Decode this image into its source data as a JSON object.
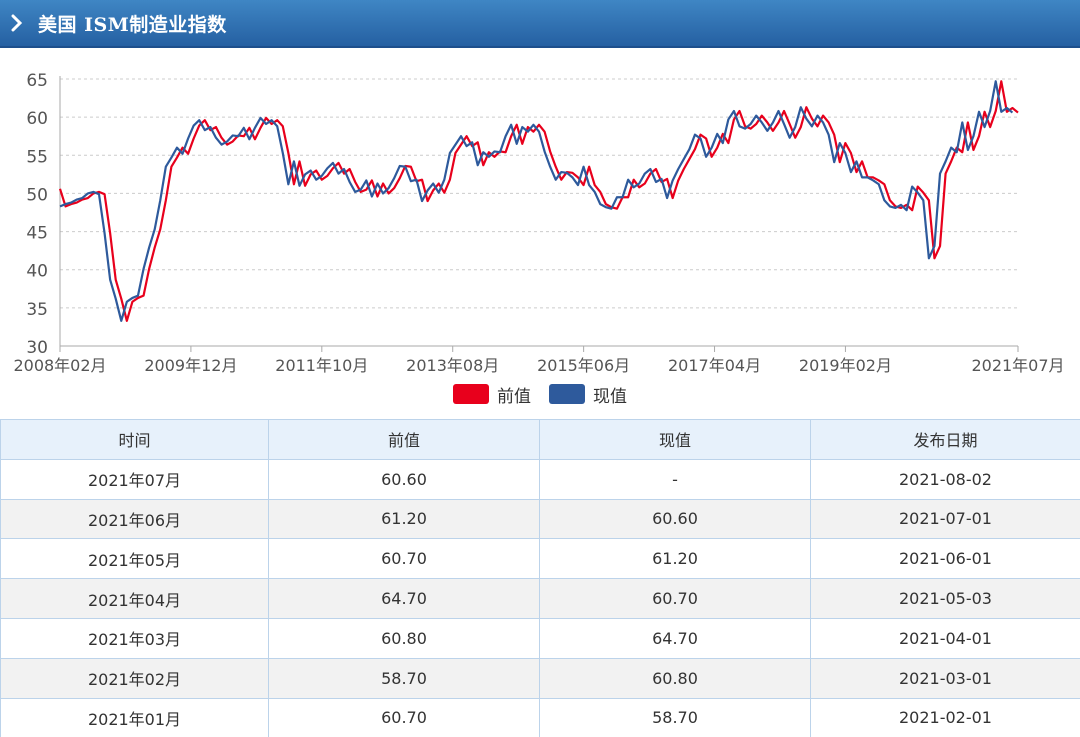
{
  "header": {
    "title": "美国 ISM制造业指数",
    "icon": "chevron-right-icon"
  },
  "chart_data": {
    "type": "line",
    "title": "",
    "xlabel": "",
    "ylabel": "",
    "ylim": [
      30,
      65
    ],
    "yticks": [
      30,
      35,
      40,
      45,
      50,
      55,
      60,
      65
    ],
    "xticks": [
      "2008年02月",
      "2009年12月",
      "2011年10月",
      "2013年08月",
      "2015年06月",
      "2017年04月",
      "2019年02月",
      "2021年07月"
    ],
    "x_start": "2008-02",
    "x_end": "2021-07",
    "grid": "horizontal dashed",
    "legend": "bottom-center",
    "series": [
      {
        "name": "前值",
        "color": "#e8001c",
        "values": [
          50.6,
          48.3,
          48.6,
          48.8,
          49.2,
          49.4,
          50.0,
          50.2,
          49.9,
          44.8,
          38.7,
          36.2,
          33.3,
          35.8,
          36.3,
          36.6,
          40.1,
          42.9,
          45.3,
          49.1,
          53.5,
          54.7,
          56.0,
          55.2,
          57.2,
          58.9,
          59.6,
          58.3,
          58.7,
          57.3,
          56.4,
          56.8,
          57.6,
          57.5,
          58.6,
          57.1,
          58.6,
          59.9,
          59.1,
          59.6,
          58.8,
          55.3,
          51.2,
          54.2,
          51.0,
          52.5,
          53.0,
          51.8,
          52.3,
          53.3,
          54.0,
          52.6,
          53.2,
          51.5,
          50.2,
          50.5,
          51.7,
          49.6,
          51.3,
          50.0,
          50.7,
          52.0,
          53.6,
          53.5,
          51.6,
          51.8,
          49.0,
          50.4,
          51.3,
          50.1,
          51.8,
          55.3,
          56.4,
          57.5,
          56.2,
          56.7,
          53.7,
          55.4,
          54.8,
          55.5,
          55.4,
          57.5,
          59.0,
          56.5,
          58.7,
          58.1,
          59.0,
          58.1,
          55.5,
          53.5,
          51.8,
          52.8,
          52.7,
          52.1,
          51.1,
          53.5,
          51.1,
          50.2,
          48.6,
          48.2,
          48.0,
          49.5,
          49.5,
          51.8,
          50.8,
          51.3,
          52.6,
          53.2,
          51.5,
          51.9,
          49.4,
          51.7,
          53.2,
          54.5,
          55.8,
          57.7,
          57.2,
          54.8,
          56.0,
          57.8,
          56.6,
          59.7,
          60.8,
          58.8,
          58.5,
          59.1,
          60.2,
          59.3,
          58.2,
          59.3,
          60.8,
          59.1,
          57.3,
          58.7,
          61.3,
          59.8,
          58.8,
          60.2,
          59.3,
          57.7,
          54.1,
          56.6,
          55.3,
          52.8,
          54.2,
          52.1,
          52.1,
          51.7,
          51.2,
          49.1,
          48.3,
          48.1,
          48.5,
          47.8,
          50.9,
          50.1,
          49.1,
          41.5,
          43.1,
          52.6,
          54.2,
          56.0,
          55.4,
          59.3,
          55.7,
          57.5,
          60.7,
          58.7,
          60.8,
          64.7,
          60.7,
          61.2,
          60.6
        ]
      },
      {
        "name": "现值",
        "color": "#2e5a9c",
        "values": [
          48.3,
          48.6,
          48.8,
          49.2,
          49.4,
          50.0,
          50.2,
          49.9,
          44.8,
          38.7,
          36.2,
          33.3,
          35.8,
          36.3,
          36.6,
          40.1,
          42.9,
          45.3,
          49.1,
          53.5,
          54.7,
          56.0,
          55.2,
          57.2,
          58.9,
          59.6,
          58.3,
          58.7,
          57.3,
          56.4,
          56.8,
          57.6,
          57.5,
          58.6,
          57.1,
          58.6,
          59.9,
          59.1,
          59.6,
          58.8,
          55.3,
          51.2,
          54.2,
          51.0,
          52.5,
          53.0,
          51.8,
          52.3,
          53.3,
          54.0,
          52.6,
          53.2,
          51.5,
          50.2,
          50.5,
          51.7,
          49.6,
          51.3,
          50.0,
          50.7,
          52.0,
          53.6,
          53.5,
          51.6,
          51.8,
          49.0,
          50.4,
          51.3,
          50.1,
          51.8,
          55.3,
          56.4,
          57.5,
          56.2,
          56.7,
          53.7,
          55.4,
          54.8,
          55.5,
          55.4,
          57.5,
          59.0,
          56.5,
          58.7,
          58.1,
          59.0,
          58.1,
          55.5,
          53.5,
          51.8,
          52.8,
          52.7,
          52.1,
          51.1,
          53.5,
          51.1,
          50.2,
          48.6,
          48.2,
          48.0,
          49.5,
          49.5,
          51.8,
          50.8,
          51.3,
          52.6,
          53.2,
          51.5,
          51.9,
          49.4,
          51.7,
          53.2,
          54.5,
          55.8,
          57.7,
          57.2,
          54.8,
          56.0,
          57.8,
          56.6,
          59.7,
          60.8,
          58.8,
          58.5,
          59.1,
          60.2,
          59.3,
          58.2,
          59.3,
          60.8,
          59.1,
          57.3,
          58.7,
          61.3,
          59.8,
          58.8,
          60.2,
          59.3,
          57.7,
          54.1,
          56.6,
          55.3,
          52.8,
          54.2,
          52.1,
          52.1,
          51.7,
          51.2,
          49.1,
          48.3,
          48.1,
          48.5,
          47.8,
          50.9,
          50.1,
          49.1,
          41.5,
          43.1,
          52.6,
          54.2,
          56.0,
          55.4,
          59.3,
          55.7,
          57.5,
          60.7,
          58.7,
          60.8,
          64.7,
          60.7,
          61.2,
          60.6,
          null
        ]
      }
    ]
  },
  "table": {
    "headers": [
      "时间",
      "前值",
      "现值",
      "发布日期"
    ],
    "rows": [
      [
        "2021年07月",
        "60.60",
        "-",
        "2021-08-02"
      ],
      [
        "2021年06月",
        "61.20",
        "60.60",
        "2021-07-01"
      ],
      [
        "2021年05月",
        "60.70",
        "61.20",
        "2021-06-01"
      ],
      [
        "2021年04月",
        "64.70",
        "60.70",
        "2021-05-03"
      ],
      [
        "2021年03月",
        "60.80",
        "64.70",
        "2021-04-01"
      ],
      [
        "2021年02月",
        "58.70",
        "60.80",
        "2021-03-01"
      ],
      [
        "2021年01月",
        "60.70",
        "58.70",
        "2021-02-01"
      ]
    ]
  }
}
